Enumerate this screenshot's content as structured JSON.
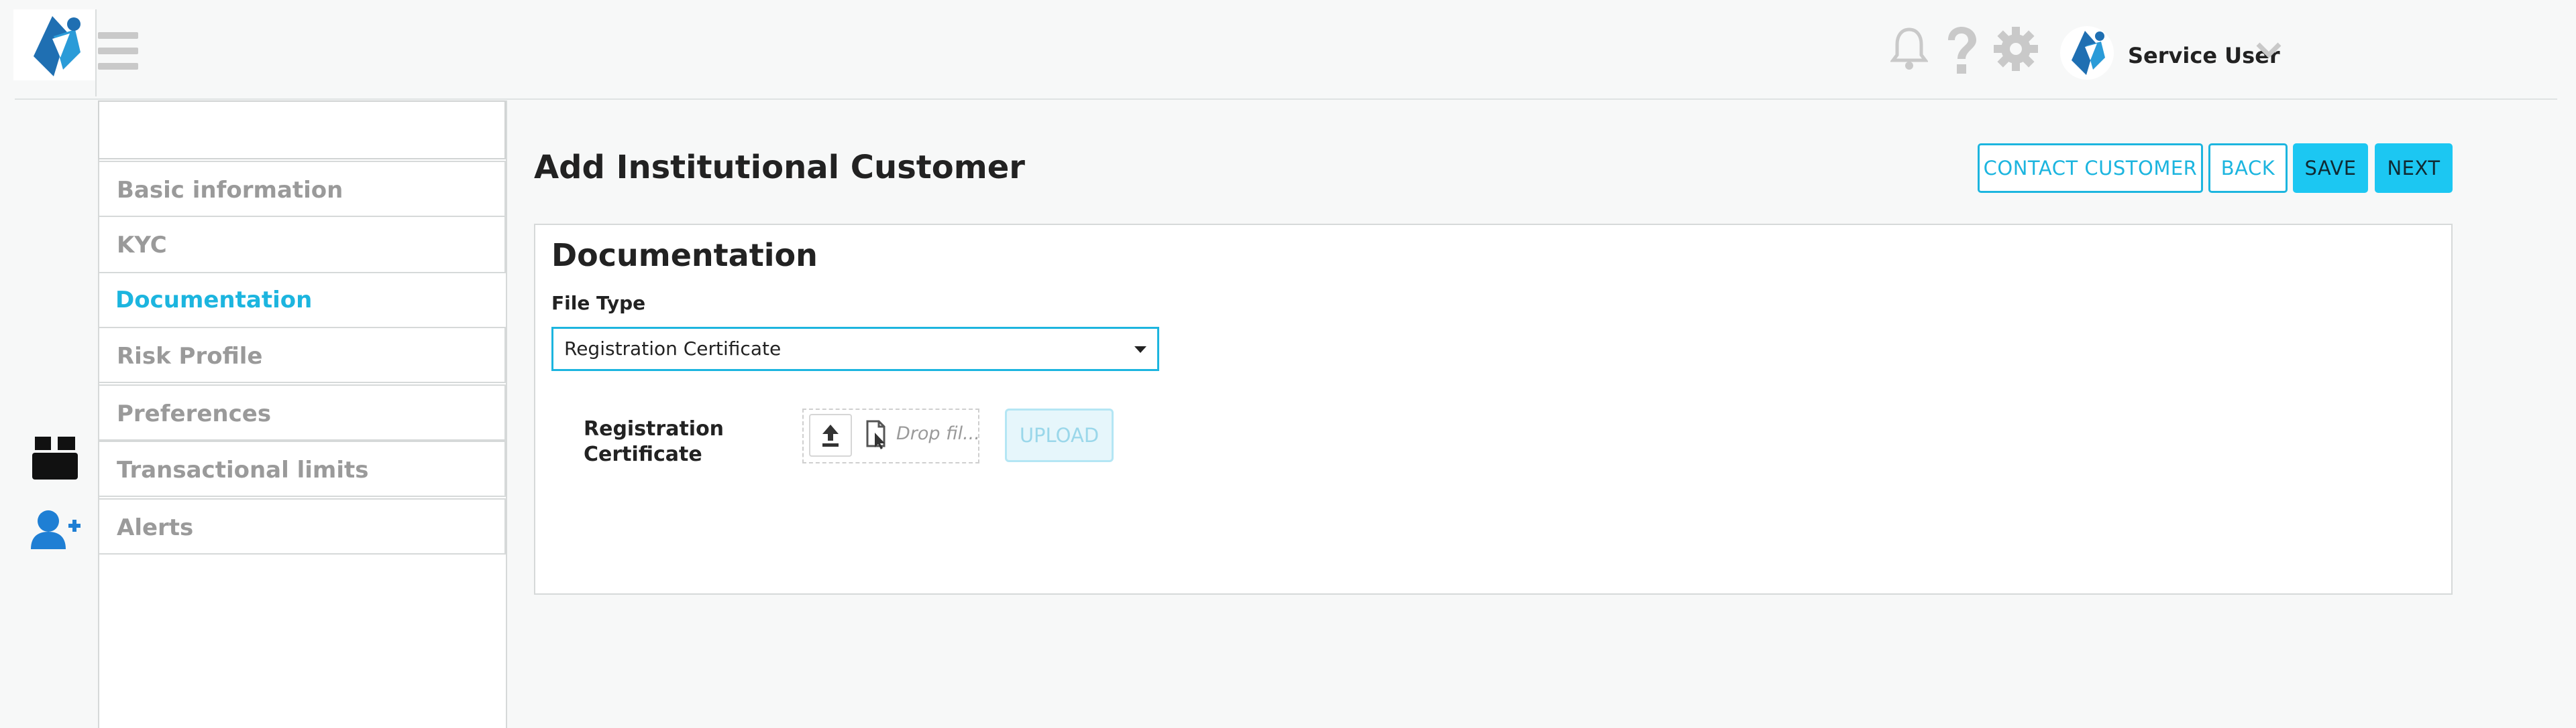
{
  "header": {
    "user_name": "Service User"
  },
  "sidebar": {
    "items": [
      {
        "label": "Basic information"
      },
      {
        "label": "KYC"
      },
      {
        "label": "Documentation"
      },
      {
        "label": "Risk Profile"
      },
      {
        "label": "Preferences"
      },
      {
        "label": "Transactional limits"
      },
      {
        "label": "Alerts"
      }
    ],
    "active_index": 2
  },
  "rail": {
    "icons": [
      "box-icon",
      "add-user-icon"
    ]
  },
  "page": {
    "title": "Add Institutional Customer",
    "actions": {
      "contact_customer": "CONTACT CUSTOMER",
      "back": "BACK",
      "save": "SAVE",
      "next": "NEXT"
    }
  },
  "documentation": {
    "section_title": "Documentation",
    "file_type_label": "File Type",
    "file_type_value": "Registration Certificate",
    "document_label": "Registration Certificate",
    "drop_text": "Drop fil...",
    "upload_label": "UPLOAD"
  },
  "colors": {
    "accent": "#1cb5df",
    "button_fill": "#1cc7f2",
    "brand_blue": "#1f6fb2",
    "muted_icon": "#c9c9c9"
  }
}
